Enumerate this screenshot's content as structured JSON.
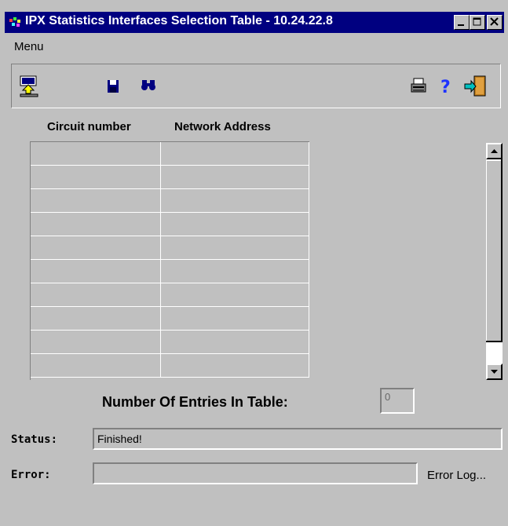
{
  "window": {
    "title": "IPX Statistics Interfaces Selection Table - 10.24.22.8"
  },
  "menubar": {
    "menu_label": "Menu"
  },
  "toolbar": {
    "left_tools": [
      "upload-icon",
      "save-icon",
      "find-icon"
    ],
    "right_tools": [
      "print-icon",
      "help-icon",
      "exit-icon"
    ]
  },
  "table": {
    "columns": [
      "Circuit number",
      "Network Address"
    ],
    "rows": [
      [
        "",
        ""
      ],
      [
        "",
        ""
      ],
      [
        "",
        ""
      ],
      [
        "",
        ""
      ],
      [
        "",
        ""
      ],
      [
        "",
        ""
      ],
      [
        "",
        ""
      ],
      [
        "",
        ""
      ],
      [
        "",
        ""
      ],
      [
        "",
        ""
      ]
    ]
  },
  "entries": {
    "label": "Number Of Entries In Table:",
    "value": "0"
  },
  "status": {
    "label": "Status:",
    "value": "Finished!"
  },
  "error": {
    "label": "Error:",
    "value": "",
    "log_label": "Error Log..."
  },
  "colors": {
    "titlebar": "#000080",
    "window_bg": "#c0c0c0",
    "help_icon": "#1e32ff"
  }
}
